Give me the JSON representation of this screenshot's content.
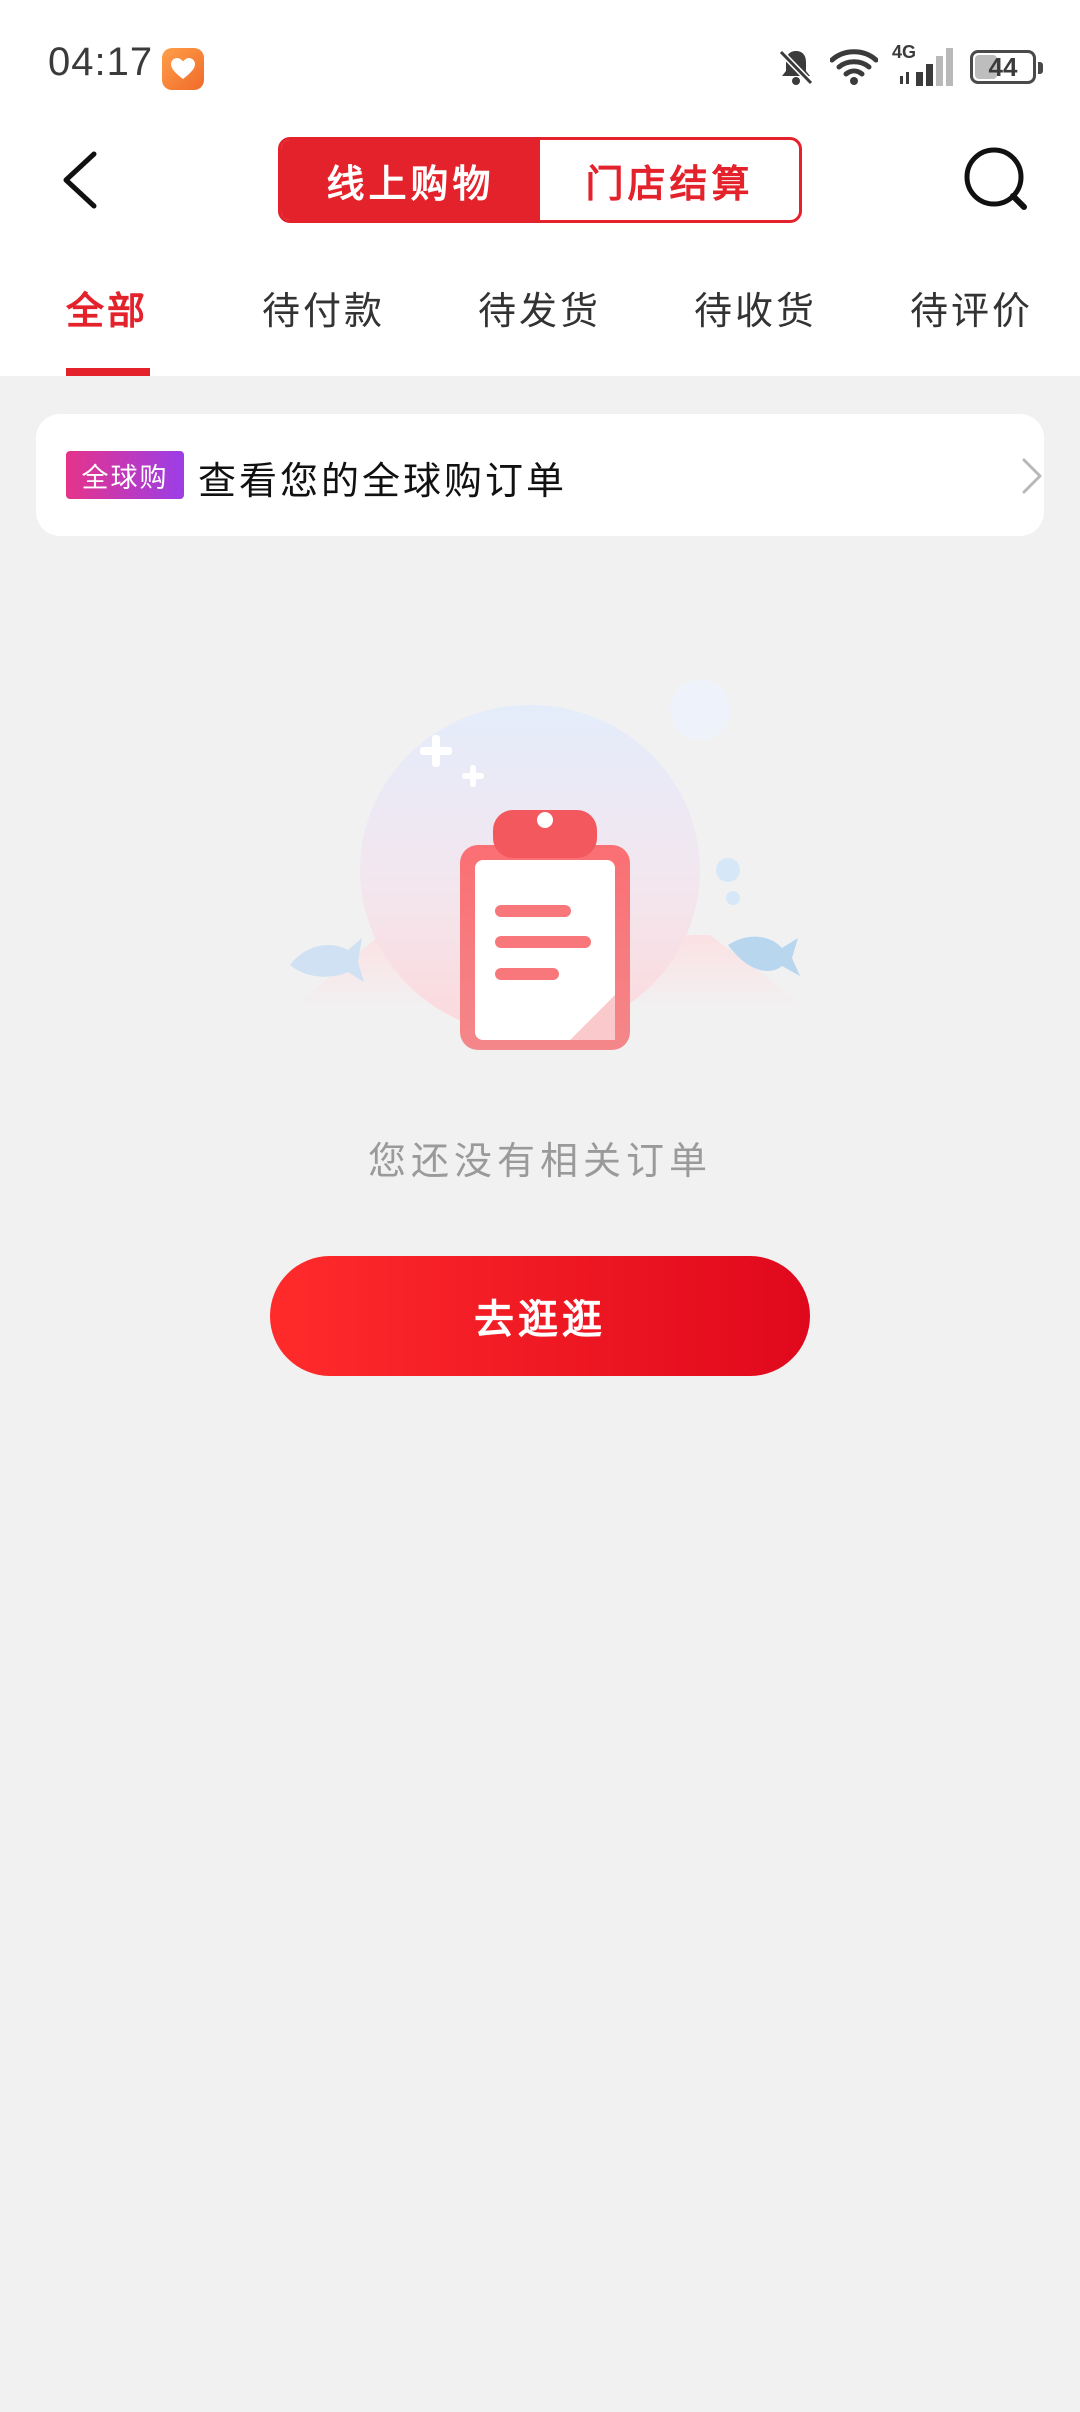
{
  "status_bar": {
    "time": "04:17",
    "network": "4G",
    "battery": "44",
    "battery_percent": 44
  },
  "header": {
    "segments": [
      {
        "label": "线上购物",
        "active": true
      },
      {
        "label": "门店结算",
        "active": false
      }
    ],
    "back_icon": "back-arrow-icon",
    "search_icon": "search-icon"
  },
  "tabs": [
    {
      "label": "全部",
      "active": true
    },
    {
      "label": "待付款",
      "active": false
    },
    {
      "label": "待发货",
      "active": false
    },
    {
      "label": "待收货",
      "active": false
    },
    {
      "label": "待评价",
      "active": false
    }
  ],
  "global_card": {
    "badge": "全球购",
    "text": "查看您的全球购订单"
  },
  "empty_state": {
    "message": "您还没有相关订单",
    "button_label": "去逛逛"
  },
  "colors": {
    "accent": "#e3222b",
    "background": "#f1f1f2"
  }
}
